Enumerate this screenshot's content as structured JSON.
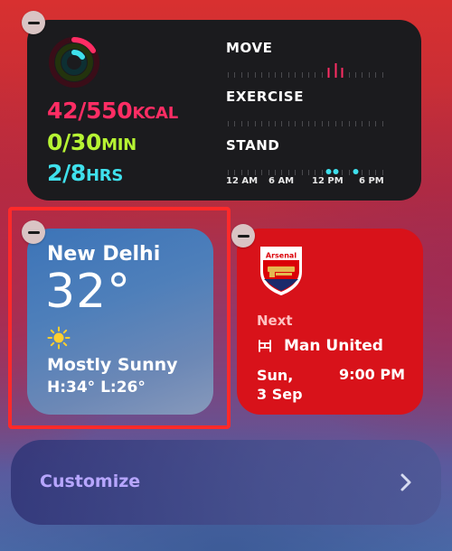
{
  "activity": {
    "move": {
      "value": "42/550",
      "unit": "KCAL",
      "color": "#ff2d64"
    },
    "exercise": {
      "value": "0/30",
      "unit": "MIN",
      "color": "#b6f433"
    },
    "stand": {
      "value": "2/8",
      "unit": "HRS",
      "color": "#3fe0ec"
    },
    "labels": {
      "move": "MOVE",
      "exercise": "EXERCISE",
      "stand": "STAND"
    },
    "hours": [
      "12 AM",
      "6 AM",
      "12 PM",
      "6 PM"
    ],
    "move_hours_active": [
      15,
      16,
      17
    ],
    "stand_hours_active": [
      15,
      16,
      19
    ]
  },
  "weather": {
    "city": "New Delhi",
    "temperature": "32°",
    "condition": "Mostly Sunny",
    "high_low": "H:34° L:26°",
    "icon": "sun-icon"
  },
  "football": {
    "team": "Arsenal",
    "next_label": "Next",
    "opponent": "Man United",
    "date_line1": "Sun,",
    "date_line2": "3 Sep",
    "kickoff": "9:00 PM",
    "icon": "stadium-icon",
    "color": "#d8121a"
  },
  "customize": {
    "label": "Customize"
  }
}
